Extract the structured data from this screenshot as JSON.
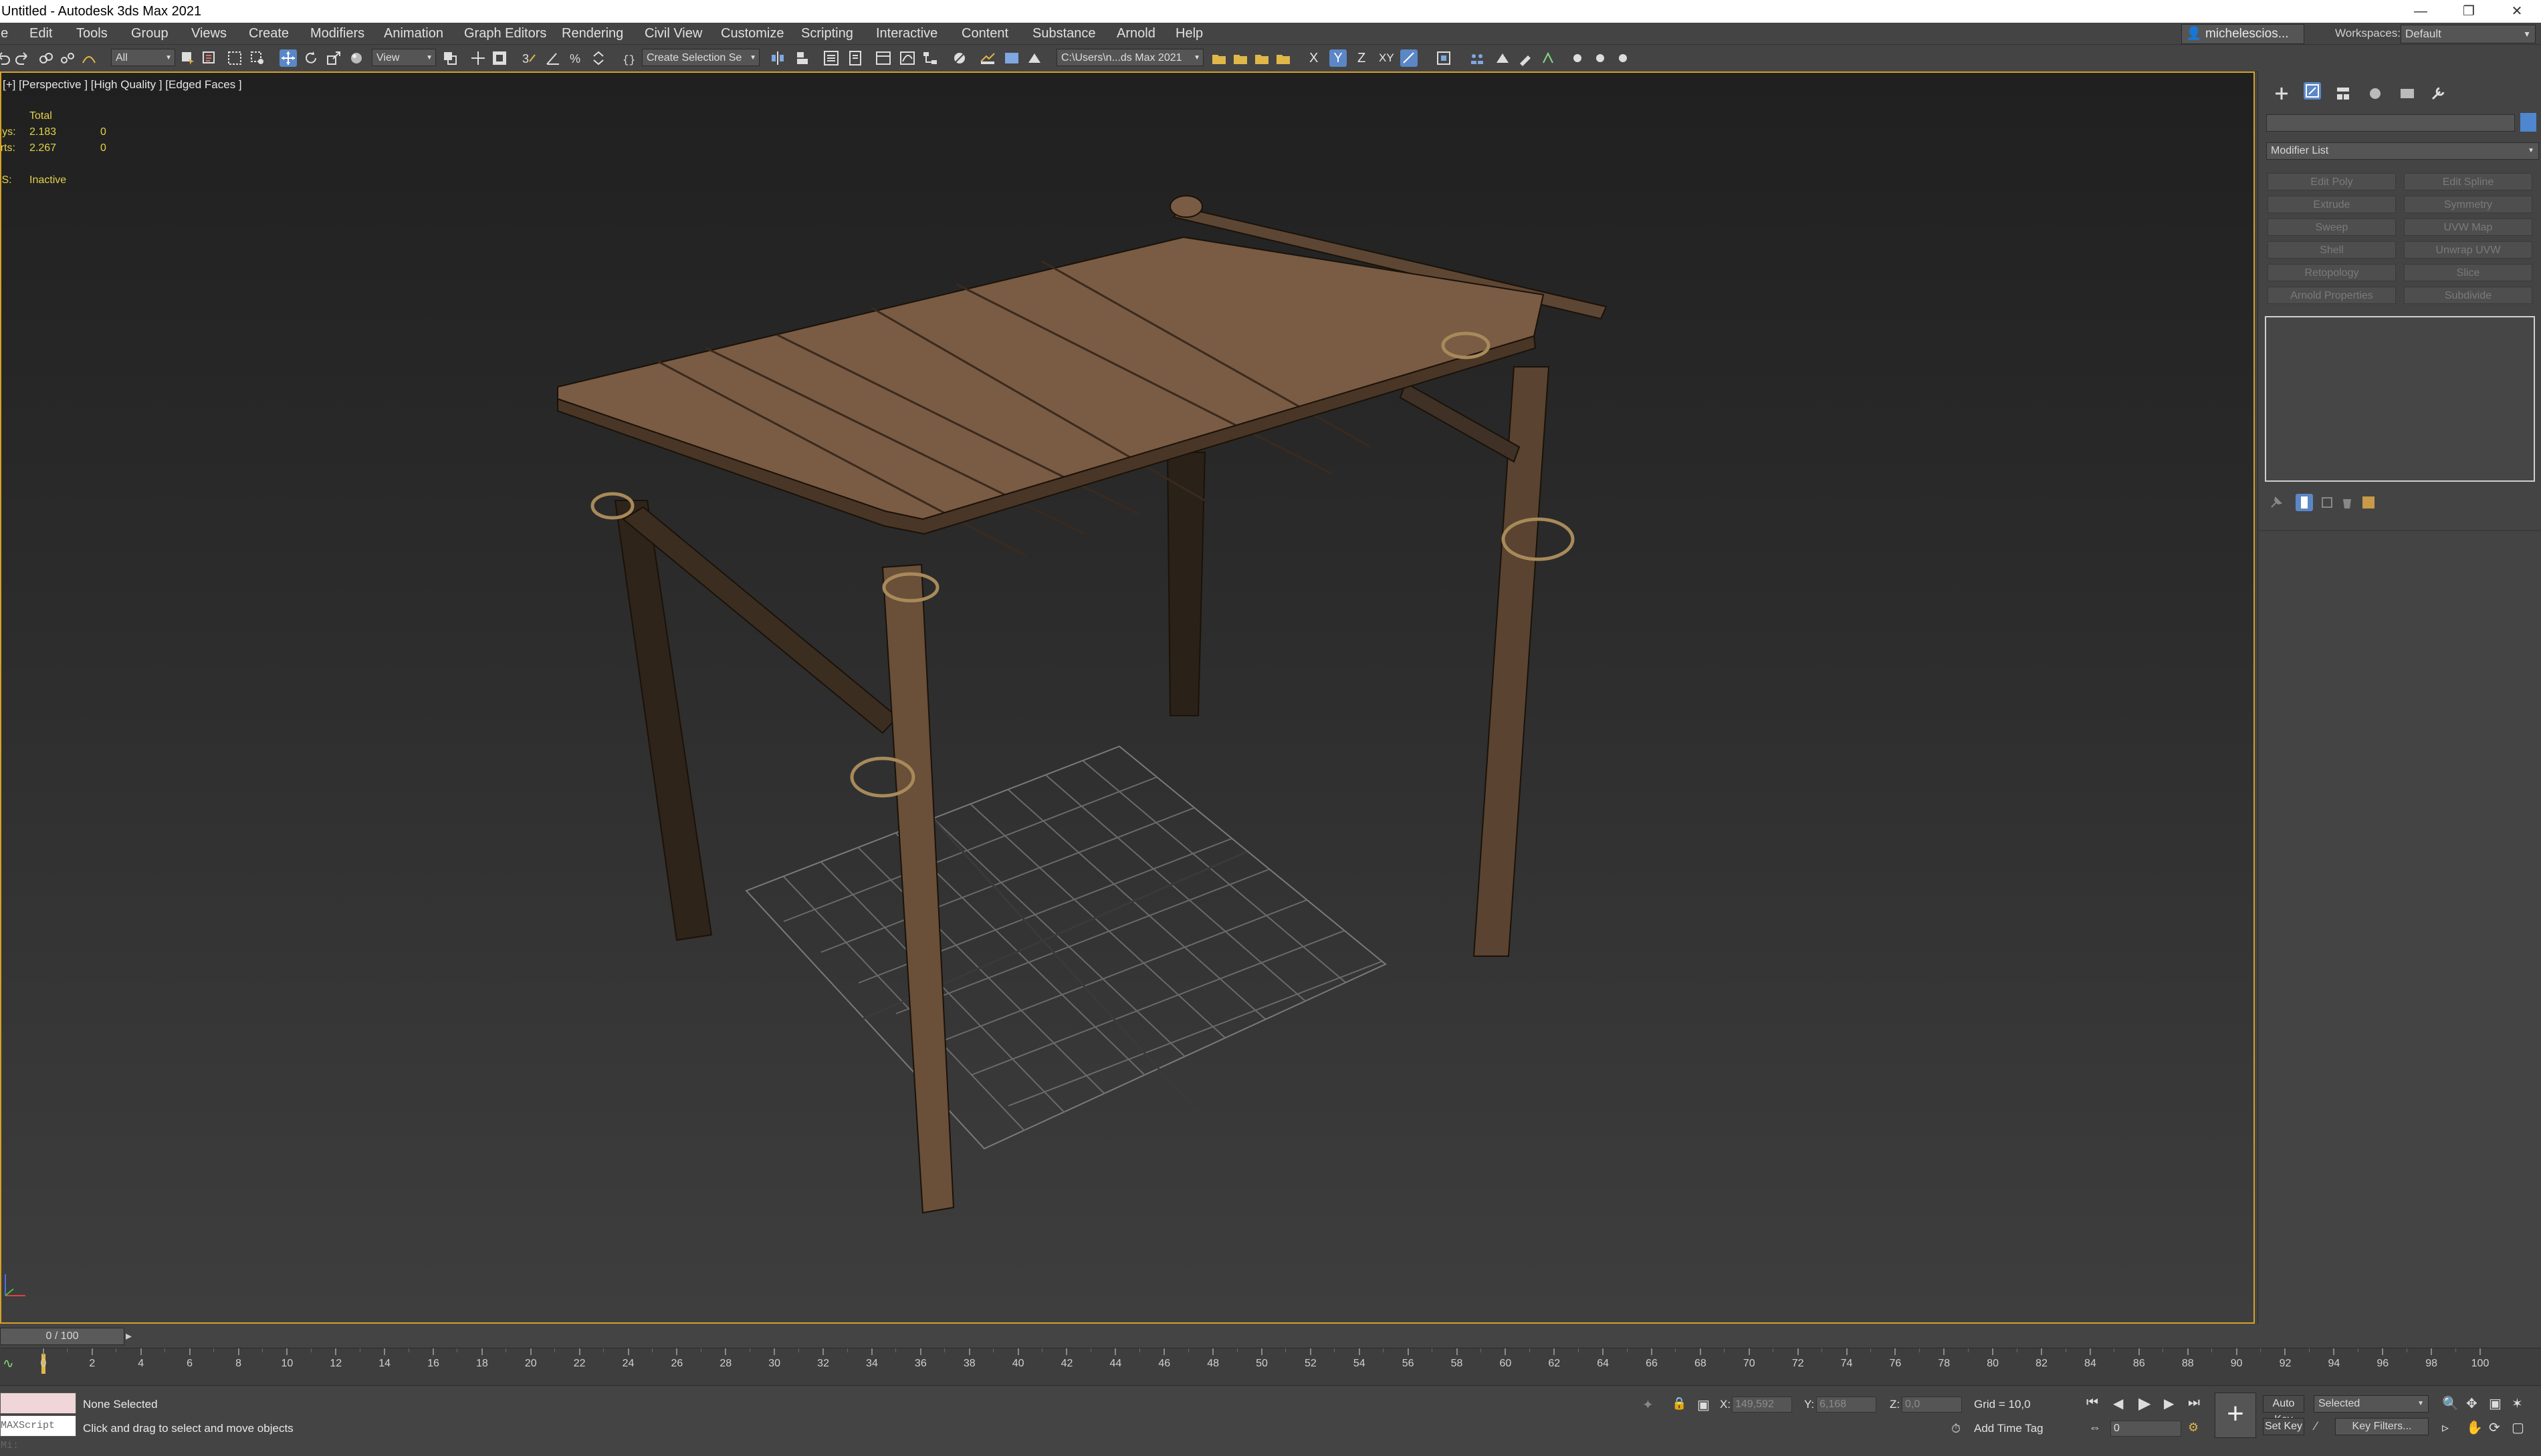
{
  "window": {
    "title": "Untitled - Autodesk 3ds Max 2021",
    "controls": [
      "—",
      "❐",
      "✕"
    ]
  },
  "menu": {
    "items": [
      "File",
      "Edit",
      "Tools",
      "Group",
      "Views",
      "Create",
      "Modifiers",
      "Animation",
      "Graph Editors",
      "Rendering",
      "Civil View",
      "Customize",
      "Scripting",
      "Interactive",
      "Content",
      "Substance",
      "Arnold",
      "Help"
    ],
    "user": "michelescios...",
    "workspaces_label": "Workspaces:",
    "workspace": "Default"
  },
  "toolbar": {
    "selection_filter": "All",
    "reference_coord": "View",
    "selection_set": "Create Selection Se",
    "project_path": "C:\\Users\\n...ds Max 2021",
    "axes": [
      "X",
      "Y",
      "Z",
      "XY"
    ],
    "active_axis": "Y",
    "accent": "#5b87c7"
  },
  "viewport": {
    "label": "[+] [Perspective ] [High Quality ] [Edged Faces ]",
    "stats": {
      "total_label": "Total",
      "polys_label": "Polys:",
      "polys_total": "2.183",
      "polys_sel": "0",
      "verts_label": "Verts:",
      "verts_total": "2.267",
      "verts_sel": "0",
      "fps_label": "FPS:",
      "fps_value": "Inactive"
    },
    "border_color": "#d4a228"
  },
  "command_panel": {
    "modifier_list": "Modifier List",
    "buttons": [
      "Edit Poly",
      "Edit Spline",
      "Extrude",
      "Symmetry",
      "Sweep",
      "UVW Map",
      "Shell",
      "Unwrap UVW",
      "Retopology",
      "Slice",
      "Arnold Properties",
      "Subdivide"
    ]
  },
  "timeline": {
    "frame": "0 / 100",
    "ticks": [
      "0",
      "2",
      "4",
      "6",
      "8",
      "10",
      "12",
      "14",
      "16",
      "18",
      "20",
      "22",
      "24",
      "26",
      "28",
      "30",
      "32",
      "34",
      "36",
      "38",
      "40",
      "42",
      "44",
      "46",
      "48",
      "50",
      "52",
      "54",
      "56",
      "58",
      "60",
      "62",
      "64",
      "66",
      "68",
      "70",
      "72",
      "74",
      "76",
      "78",
      "80",
      "82",
      "84",
      "86",
      "88",
      "90",
      "92",
      "94",
      "96",
      "98",
      "100"
    ]
  },
  "status": {
    "script_listener": "MAXScript Mi:",
    "selection": "None Selected",
    "prompt": "Click and drag to select and move objects",
    "x_label": "X:",
    "x_value": "149,592",
    "y_label": "Y:",
    "y_value": "6,168",
    "z_label": "Z:",
    "z_value": "0,0",
    "grid": "Grid = 10,0",
    "add_time_tag": "Add Time Tag",
    "auto_key": "Auto Key",
    "set_key": "Set Key",
    "key_mode": "Selected",
    "key_filters": "Key Filters...",
    "current_frame": "0"
  }
}
